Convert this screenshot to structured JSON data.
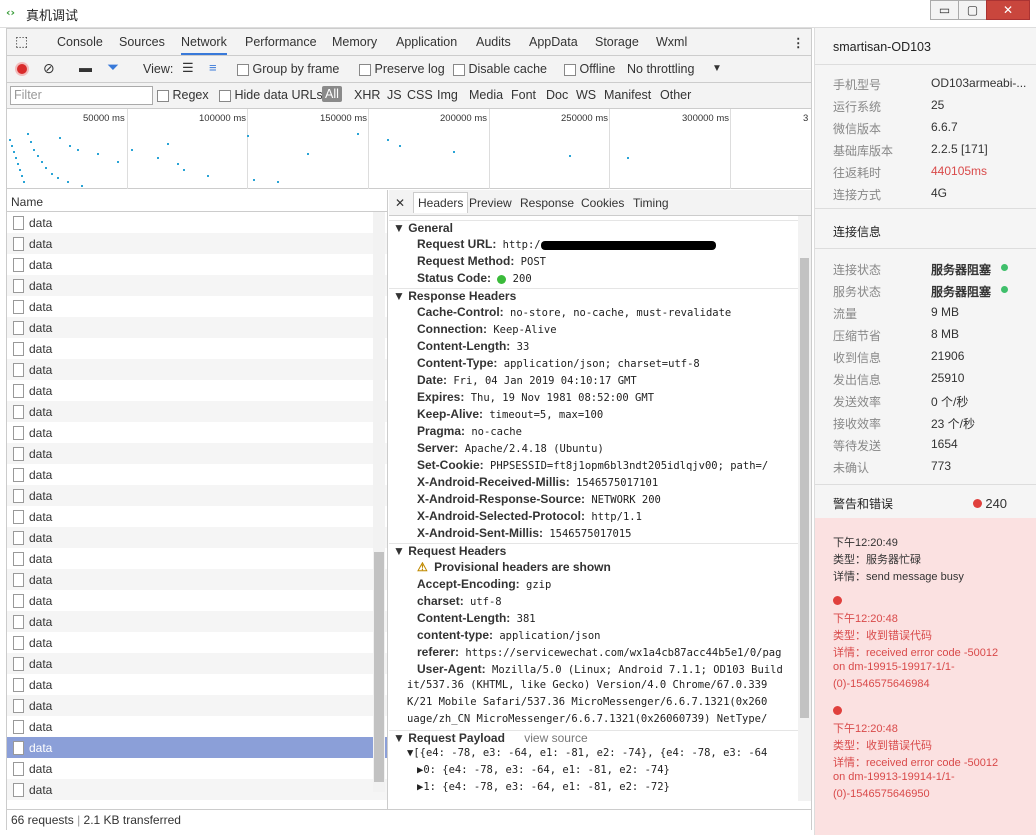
{
  "window": {
    "title": "真机调试",
    "min": "▭",
    "max": "▢",
    "close": "✕"
  },
  "tabs": [
    "Console",
    "Sources",
    "Network",
    "Performance",
    "Memory",
    "Application",
    "Audits",
    "AppData",
    "Storage",
    "Wxml"
  ],
  "toolbar": {
    "view": "View:",
    "group_by_frame": "Group by frame",
    "preserve_log": "Preserve log",
    "disable_cache": "Disable cache",
    "offline": "Offline",
    "throttling": "No throttling"
  },
  "filterbar": {
    "placeholder": "Filter",
    "regex": "Regex",
    "hide_data_urls": "Hide data URLs",
    "types": [
      "All",
      "XHR",
      "JS",
      "CSS",
      "Img",
      "Media",
      "Font",
      "Doc",
      "WS",
      "Manifest",
      "Other"
    ]
  },
  "overview": {
    "ticks": [
      "50000 ms",
      "100000 ms",
      "150000 ms",
      "200000 ms",
      "250000 ms",
      "300000 ms",
      "3"
    ]
  },
  "reqlist": {
    "header": "Name",
    "item_label": "data",
    "count": 28,
    "selected_index": 25
  },
  "status": {
    "requests": "66 requests",
    "sep": "|",
    "transferred": "2.1 KB transferred"
  },
  "detail": {
    "tabs": [
      "Headers",
      "Preview",
      "Response",
      "Cookies",
      "Timing"
    ],
    "general_title": "General",
    "general": [
      [
        "Request URL:",
        "http:/"
      ],
      [
        "Request Method:",
        "POST"
      ],
      [
        "Status Code:",
        "200"
      ]
    ],
    "response_title": "Response Headers",
    "response": [
      [
        "Cache-Control:",
        "no-store, no-cache, must-revalidate"
      ],
      [
        "Connection:",
        "Keep-Alive"
      ],
      [
        "Content-Length:",
        "33"
      ],
      [
        "Content-Type:",
        "application/json; charset=utf-8"
      ],
      [
        "Date:",
        "Fri, 04 Jan 2019 04:10:17 GMT"
      ],
      [
        "Expires:",
        "Thu, 19 Nov 1981 08:52:00 GMT"
      ],
      [
        "Keep-Alive:",
        "timeout=5, max=100"
      ],
      [
        "Pragma:",
        "no-cache"
      ],
      [
        "Server:",
        "Apache/2.4.18 (Ubuntu)"
      ],
      [
        "Set-Cookie:",
        "PHPSESSID=ft8j1opm6bl3ndt205idlqjv00; path=/"
      ],
      [
        "X-Android-Received-Millis:",
        "1546575017101"
      ],
      [
        "X-Android-Response-Source:",
        "NETWORK 200"
      ],
      [
        "X-Android-Selected-Protocol:",
        "http/1.1"
      ],
      [
        "X-Android-Sent-Millis:",
        "1546575017015"
      ]
    ],
    "request_title": "Request Headers",
    "provisional": "Provisional headers are shown",
    "request": [
      [
        "Accept-Encoding:",
        "gzip"
      ],
      [
        "charset:",
        "utf-8"
      ],
      [
        "Content-Length:",
        "381"
      ],
      [
        "content-type:",
        "application/json"
      ],
      [
        "referer:",
        "https://servicewechat.com/wx1a4cb87acc44b5e1/0/pag"
      ],
      [
        "User-Agent:",
        "Mozilla/5.0 (Linux; Android 7.1.1; OD103 Build"
      ]
    ],
    "ua_cont": [
      "it/537.36 (KHTML, like Gecko) Version/4.0 Chrome/67.0.339",
      "K/21 Mobile Safari/537.36 MicroMessenger/6.6.7.1321(0x260",
      "uage/zh_CN MicroMessenger/6.6.7.1321(0x26060739) NetType/"
    ],
    "payload_title": "Request Payload",
    "view_source": "view source",
    "payload": [
      "▼[{e4: -78, e3: -64, e1: -81, e2: -74}, {e4: -78, e3: -64",
      "▶0: {e4: -78, e3: -64, e1: -81, e2: -74}",
      "▶1: {e4: -78, e3: -64, e1: -81, e2: -72}"
    ]
  },
  "side": {
    "device": "smartisan-OD103",
    "info": [
      [
        "手机型号",
        "OD103armeabi-..."
      ],
      [
        "运行系统",
        "25"
      ],
      [
        "微信版本",
        "6.6.7"
      ],
      [
        "基础库版本",
        "2.2.5 [171]"
      ],
      [
        "往返耗时",
        "440105ms"
      ],
      [
        "连接方式",
        "4G"
      ]
    ],
    "conn_title": "连接信息",
    "conn": [
      [
        "连接状态",
        "服务器阻塞"
      ],
      [
        "服务状态",
        "服务器阻塞"
      ],
      [
        "流量",
        "9 MB"
      ],
      [
        "压缩节省",
        "8 MB"
      ],
      [
        "收到信息",
        "21906"
      ],
      [
        "发出信息",
        "25910"
      ],
      [
        "发送效率",
        "0 个/秒"
      ],
      [
        "接收效率",
        "23 个/秒"
      ],
      [
        "等待发送",
        "1654"
      ],
      [
        "未确认",
        "773"
      ]
    ],
    "warn_title": "警告和错误",
    "warn_count": "240",
    "errors": [
      {
        "time": "下午12:20:49",
        "type": "类型：服务器忙碌",
        "detail": "详情：send message busy"
      },
      {
        "time": "下午12:20:48",
        "type": "类型：收到错误代码",
        "detail": "详情：received error code -50012",
        "l2": "on dm-19915-19917-1/1-",
        "l3": "(0)-1546575646984"
      },
      {
        "time": "下午12:20:48",
        "type": "类型：收到错误代码",
        "detail": "详情：received error code -50012",
        "l2": "on dm-19913-19914-1/1-",
        "l3": "(0)-1546575646950"
      }
    ]
  }
}
